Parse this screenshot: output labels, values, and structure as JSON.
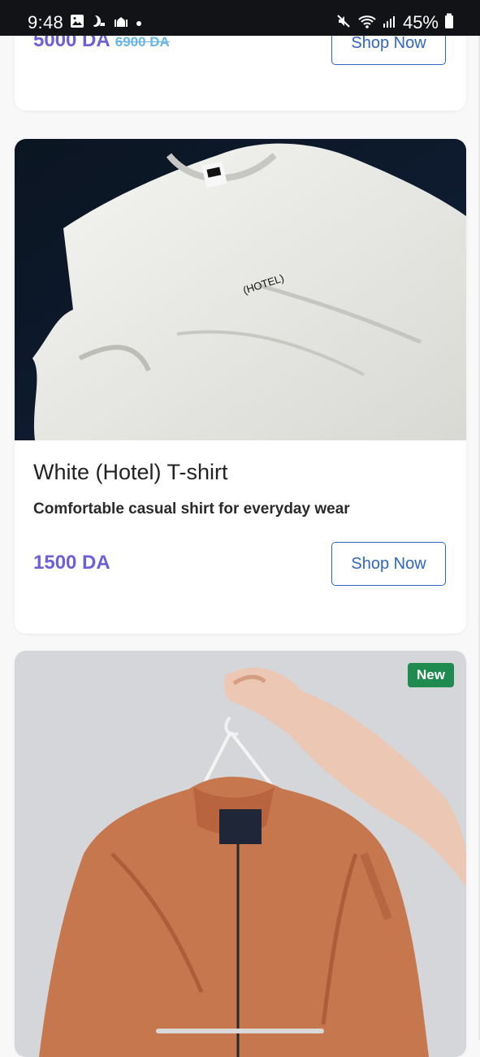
{
  "status_bar": {
    "time": "9:48",
    "battery": "45%",
    "icons": [
      "gallery-icon",
      "sleep-icon",
      "mosque-icon",
      "dot-icon",
      "mute-icon",
      "wifi-icon",
      "signal-icon",
      "battery-icon"
    ]
  },
  "cards": [
    {
      "price": "5000 DA",
      "old_price": "6900 DA",
      "button": "Shop Now"
    },
    {
      "title": "White (Hotel) T-shirt",
      "description": "Comfortable casual shirt for everyday wear",
      "price": "1500 DA",
      "button": "Shop Now",
      "shirt_print": "(HOTEL)"
    },
    {
      "badge": "New"
    }
  ],
  "colors": {
    "price": "#6d5fd8",
    "old_price": "#66b6ea",
    "button": "#2f65c2",
    "badge": "#1f8b4f"
  }
}
